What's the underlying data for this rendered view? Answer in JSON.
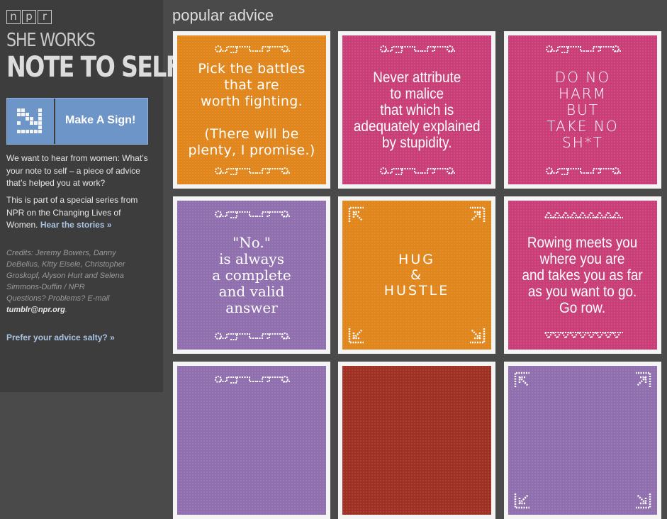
{
  "brand": {
    "logo_letters": [
      "n",
      "p",
      "r"
    ],
    "series": "SHE WORKS",
    "title": "NOTE TO SELF"
  },
  "sign_button": {
    "label": "Make A Sign!",
    "icon": "pixel-sign-icon"
  },
  "sidebar": {
    "intro": "We want to hear from women: What’s your note to self – a piece of advice that’s helped you at work?",
    "series_text": "This is part of a special series from NPR on the Changing Lives of Women.",
    "series_link": "Hear the stories »",
    "credits": "Credits: Jeremy Bowers, Danny DeBelius, Kitty Eisele, Christopher Groskopf, Alyson Hurt and Selena Simmons-Duffin / NPR",
    "questions": "Questions? Problems? E-mail",
    "email": "tumblr@npr.org",
    "email_suffix": ".",
    "salty_link": "Prefer your advice salty? »"
  },
  "main": {
    "title": "popular advice",
    "cards": [
      {
        "color": "#e0861c",
        "style": "script",
        "lines": [
          "Pick the battles",
          "that are",
          "worth fighting.",
          "",
          "(There will be",
          "plenty, I promise.)"
        ]
      },
      {
        "color": "#c93e77",
        "style": "cond",
        "lines": [
          "Never attribute",
          "to malice",
          "that which is",
          "adequately explained",
          "by stupidity."
        ]
      },
      {
        "color": "#c93e77",
        "style": "thin",
        "lines": [
          "DO NO",
          "HARM",
          "BUT",
          "TAKE NO",
          "SH*T"
        ]
      },
      {
        "color": "#906fae",
        "style": "serif",
        "lines": [
          "\"No.\"",
          "is always",
          "a complete",
          "and valid",
          "answer"
        ]
      },
      {
        "color": "#e0861c",
        "style": "hug",
        "lines": [
          "HUG",
          "&",
          "HUSTLE"
        ]
      },
      {
        "color": "#c93e77",
        "style": "cond",
        "lines": [
          "Rowing meets you",
          "where you are",
          "and takes you as far",
          "as you want to go.",
          "Go row."
        ]
      },
      {
        "color": "#906fae",
        "style": "serif",
        "lines": []
      },
      {
        "color": "#9e3124",
        "style": "serif",
        "lines": []
      },
      {
        "color": "#906fae",
        "style": "serif",
        "lines": []
      }
    ]
  }
}
